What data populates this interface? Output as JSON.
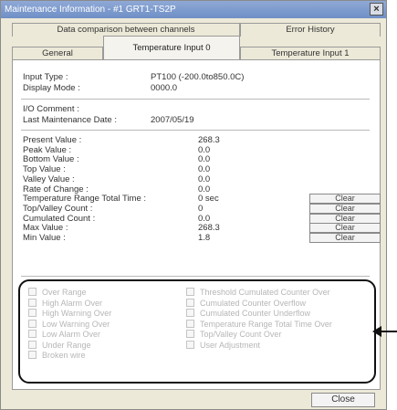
{
  "window": {
    "title": "Maintenance Information - #1 GRT1-TS2P",
    "close_glyph": "×"
  },
  "tabs_row1": [
    {
      "label": "Data comparison between channels"
    },
    {
      "label": "Error History"
    }
  ],
  "tabs_row2": [
    {
      "label": "General"
    },
    {
      "label": "Temperature Input 0"
    },
    {
      "label": "Temperature Input 1"
    }
  ],
  "info": {
    "input_type_label": "Input Type :",
    "input_type_value": "PT100 (-200.0to850.0C)",
    "display_mode_label": "Display Mode :",
    "display_mode_value": "0000.0",
    "io_comment_label": "I/O Comment :",
    "last_maint_label": "Last Maintenance Date :",
    "last_maint_value": "2007/05/19"
  },
  "values": [
    {
      "label": "Present Value :",
      "value": "268.3"
    },
    {
      "label": "Peak Value :",
      "value": "0.0"
    },
    {
      "label": "Bottom Value :",
      "value": "0.0"
    },
    {
      "label": "Top Value :",
      "value": "0.0"
    },
    {
      "label": "Valley Value :",
      "value": "0.0"
    },
    {
      "label": "Rate of Change :",
      "value": "0.0"
    },
    {
      "label": "Temperature Range Total Time :",
      "value": "0 sec"
    },
    {
      "label": "Top/Valley Count :",
      "value": "0"
    },
    {
      "label": "Cumulated Count :",
      "value": "0.0"
    },
    {
      "label": "Max Value :",
      "value": "268.3"
    },
    {
      "label": "Min Value :",
      "value": "1.8"
    }
  ],
  "clear_label": "Clear",
  "flags_left": [
    "Over Range",
    "High Alarm Over",
    "High Warning Over",
    "Low Warning Over",
    "Low Alarm Over",
    "Under Range",
    "Broken wire"
  ],
  "flags_right": [
    "Threshold Cumulated Counter Over",
    "Cumulated Counter Overflow",
    "Cumulated Counter Underflow",
    "Temperature Range Total Time Over",
    "Top/Valley Count Over",
    "User Adjustment"
  ],
  "close_button_label": "Close"
}
